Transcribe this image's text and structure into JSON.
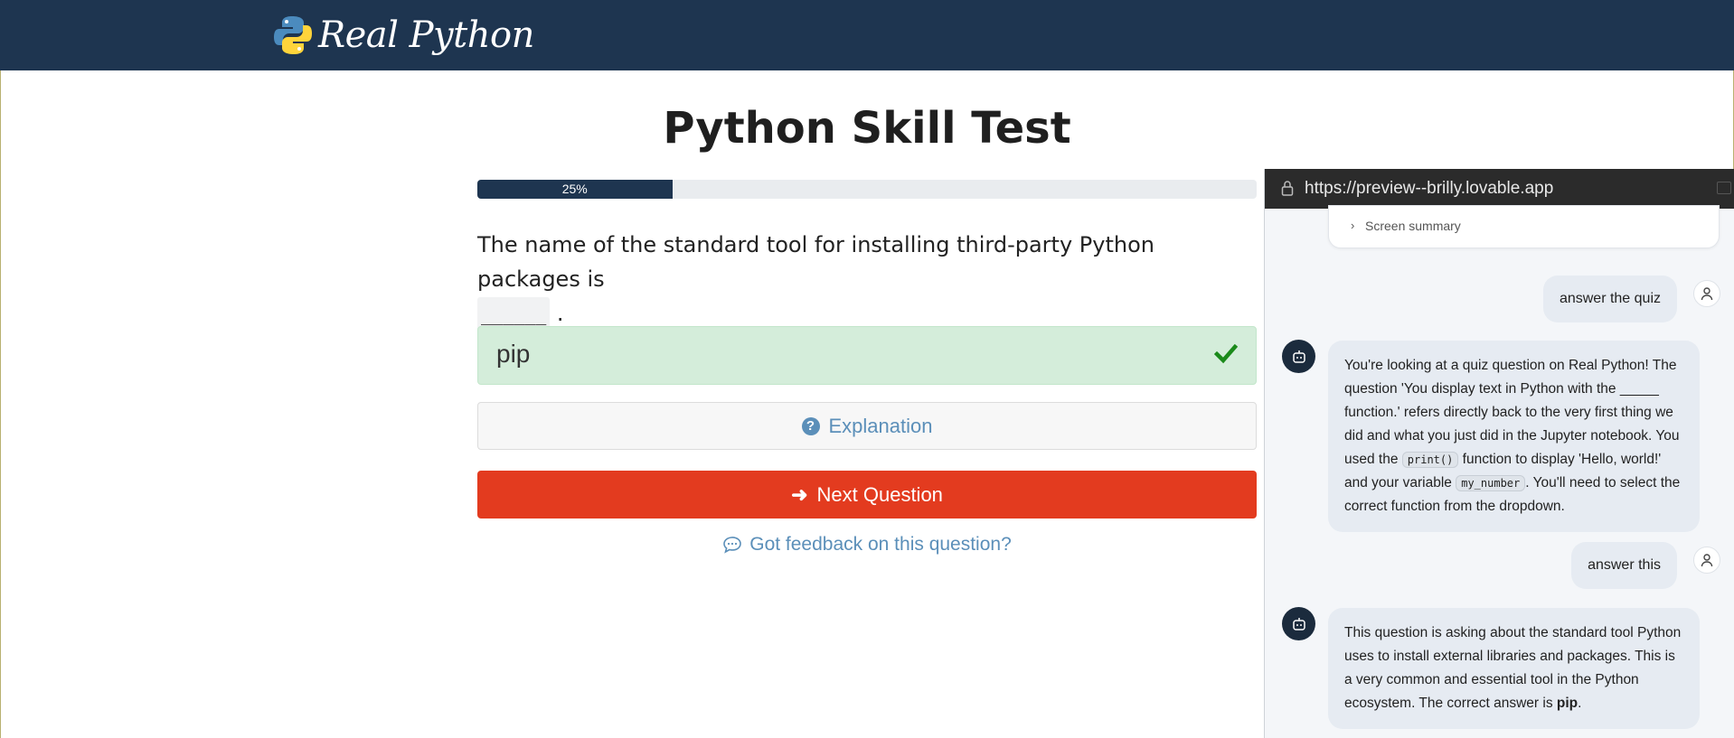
{
  "header": {
    "logo_text": "Real Python"
  },
  "quiz": {
    "title": "Python Skill Test",
    "progress_label": "25%",
    "progress_fraction": 0.25,
    "question_text": "The name of the standard tool for installing third-party Python packages is",
    "blank": "______",
    "question_end": ".",
    "answer": "pip",
    "explanation_label": "Explanation",
    "next_label": "Next Question",
    "feedback_label": "Got feedback on this question?"
  },
  "assistant": {
    "url": "https://preview--brilly.lovable.app",
    "summary_label": "Screen summary",
    "messages": [
      {
        "role": "user",
        "text": "answer the quiz"
      },
      {
        "role": "assistant",
        "parts": [
          "You're looking at a quiz question on Real Python! The question 'You display text in Python with the _____ function.' refers directly back to the very first thing we did and what you just did in the Jupyter notebook. You used the ",
          "print()",
          " function to display 'Hello, world!' and your variable ",
          "my_number",
          ". You'll need to select the correct function from the dropdown."
        ]
      },
      {
        "role": "user",
        "text": "answer this"
      },
      {
        "role": "assistant",
        "parts": [
          "This question is asking about the standard tool Python uses to install external libraries and packages. This is a very common and essential tool in the Python ecosystem. The correct answer is ",
          "pip",
          "."
        ]
      }
    ]
  },
  "colors": {
    "header_bg": "#1e3550",
    "progress_fill": "#1e3550",
    "answer_bg": "#d4edda",
    "check": "#1a8a1a",
    "next_button": "#e33b1f",
    "link": "#5b8fb9",
    "bot_avatar": "#1b2b3d"
  },
  "icons": {
    "logo": "python-logo-icon",
    "check": "checkmark-icon",
    "explanation": "question-circle-icon",
    "next": "arrow-right-icon",
    "feedback": "comment-bubble-icon",
    "lock": "lock-icon",
    "user": "user-icon",
    "bot": "robot-icon"
  }
}
